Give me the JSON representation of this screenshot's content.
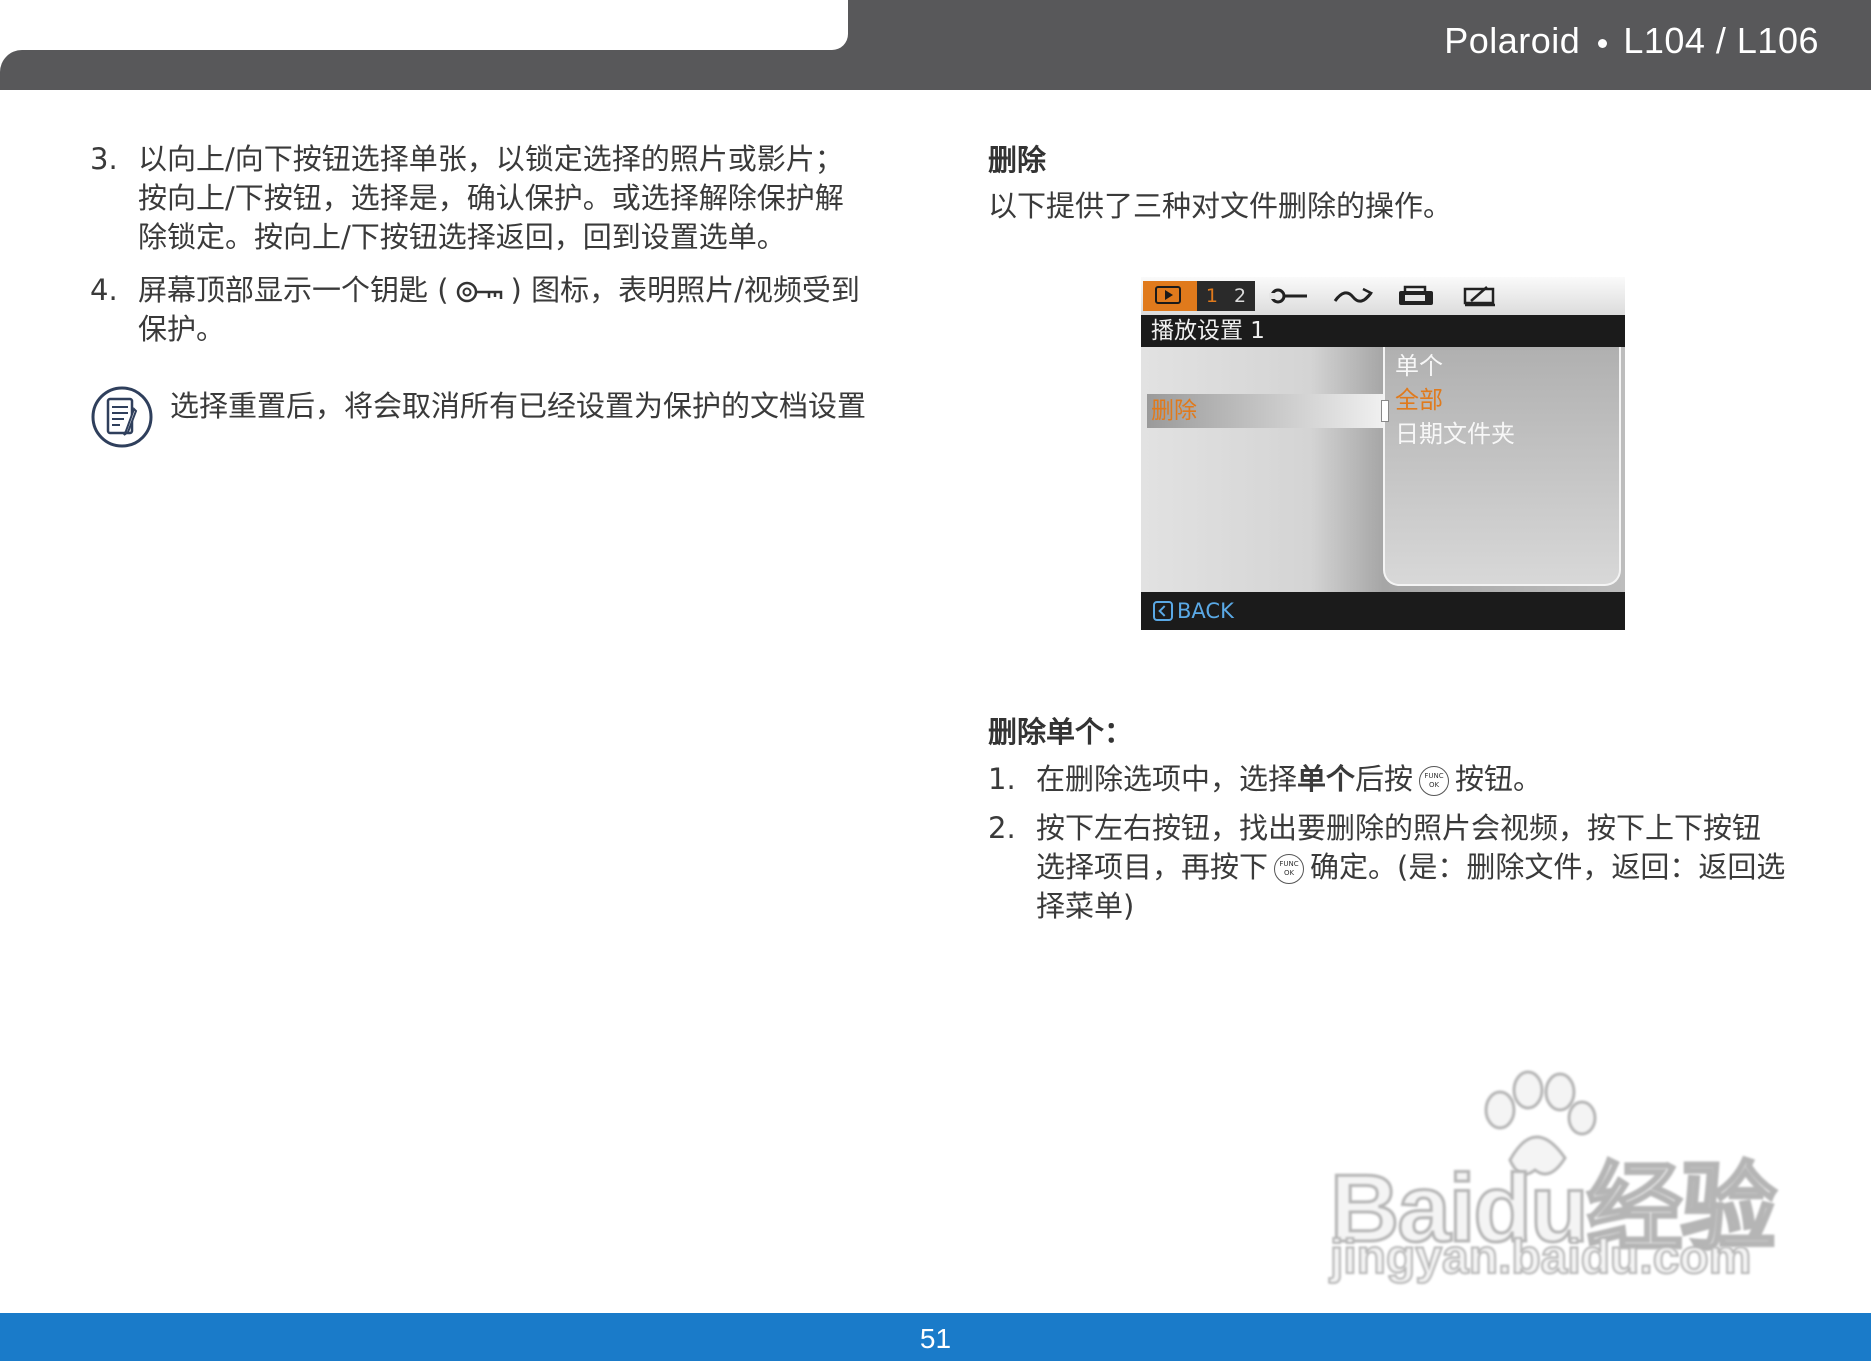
{
  "header": {
    "brand": "Polaroid",
    "model": "L104 / L106"
  },
  "left": {
    "items": [
      {
        "num": "3.",
        "text": "以向上/向下按钮选择单张，以锁定选择的照片或影片；按向上/下按钮，选择是，确认保护。或选择解除保护解除锁定。按向上/下按钮选择返回，回到设置选单。"
      },
      {
        "num": "4.",
        "text_before": "屏幕顶部显示一个钥匙 (",
        "text_after": ") 图标，表明照片/视频受到保护。"
      }
    ],
    "note": "选择重置后，将会取消所有已经设置为保护的文档设置"
  },
  "right": {
    "section_title": "删除",
    "section_text": "以下提供了三种对文件删除的操作。",
    "sub_title": "删除单个：",
    "items": [
      {
        "num": "1.",
        "text_a": "在删除选项中，选择",
        "text_bold": "单个",
        "text_b": "后按",
        "text_c": "按钮。"
      },
      {
        "num": "2.",
        "text_a": "按下左右按钮，找出要删除的照片会视频，按下上下按钮选择项目，再按下",
        "text_b": "确定。(是：删除文件，返回：返回选择菜单)"
      }
    ],
    "func_label_top": "FUNC",
    "func_label_bottom": "OK"
  },
  "camera_screen": {
    "tab_pages": [
      "1",
      "2"
    ],
    "title": "播放设置 1",
    "left_item": "删除",
    "options": [
      {
        "label": "单个",
        "selected": false
      },
      {
        "label": "全部",
        "selected": true
      },
      {
        "label": "日期文件夹",
        "selected": false
      }
    ],
    "back_label": "BACK",
    "accent_color": "#e07a1c",
    "back_color": "#5aa9e6"
  },
  "watermark": {
    "text": "Baidu经验",
    "url": "jingyan.baidu.com"
  },
  "footer": {
    "page_number": "51",
    "color": "#1a7bc9"
  }
}
